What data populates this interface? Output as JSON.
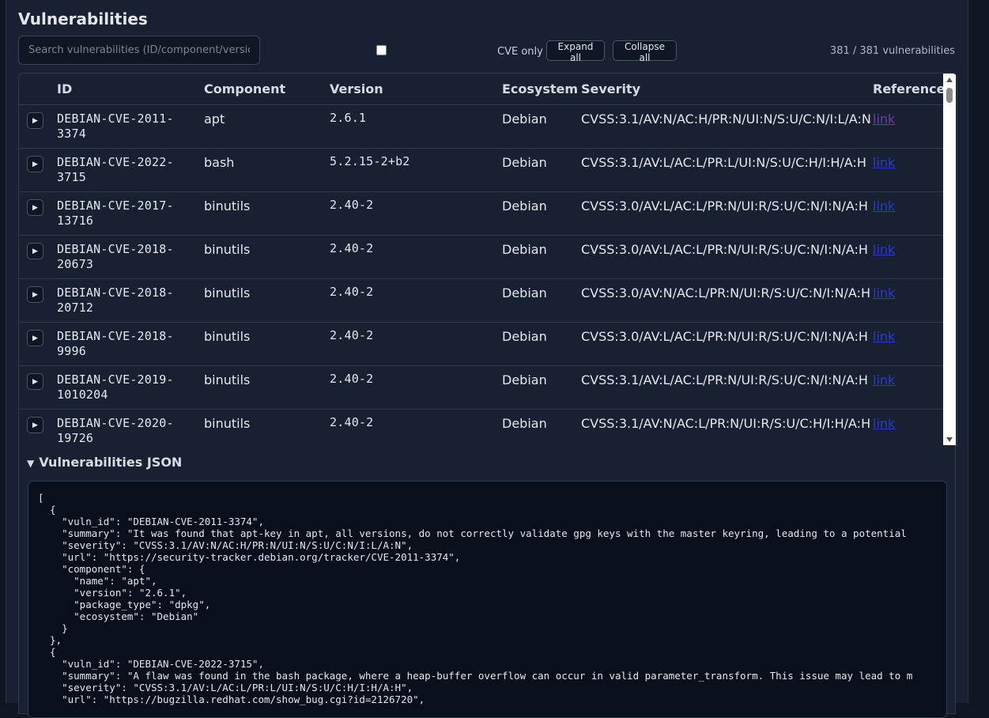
{
  "title": "Vulnerabilities",
  "search": {
    "placeholder": "Search vulnerabilities (ID/component/version/severity)"
  },
  "filters": {
    "cve_only_label": "CVE only",
    "cve_only_checked": false
  },
  "buttons": {
    "expand_all": "Expand all",
    "collapse_all": "Collapse all"
  },
  "count_label": "381 / 381 vulnerabilities",
  "table": {
    "headers": {
      "id": "ID",
      "component": "Component",
      "version": "Version",
      "ecosystem": "Ecosystem",
      "severity": "Severity",
      "reference": "Reference"
    },
    "toggle_glyph": "▶",
    "rows": [
      {
        "id": "DEBIAN-CVE-2011-3374",
        "component": "apt",
        "version": "2.6.1",
        "ecosystem": "Debian",
        "severity": "CVSS:3.1/AV:N/AC:H/PR:N/UI:N/S:U/C:N/I:L/A:N",
        "reference": "link",
        "visited": true
      },
      {
        "id": "DEBIAN-CVE-2022-3715",
        "component": "bash",
        "version": "5.2.15-2+b2",
        "ecosystem": "Debian",
        "severity": "CVSS:3.1/AV:L/AC:L/PR:L/UI:N/S:U/C:H/I:H/A:H",
        "reference": "link",
        "visited": false
      },
      {
        "id": "DEBIAN-CVE-2017-13716",
        "component": "binutils",
        "version": "2.40-2",
        "ecosystem": "Debian",
        "severity": "CVSS:3.0/AV:L/AC:L/PR:N/UI:R/S:U/C:N/I:N/A:H",
        "reference": "link",
        "visited": false
      },
      {
        "id": "DEBIAN-CVE-2018-20673",
        "component": "binutils",
        "version": "2.40-2",
        "ecosystem": "Debian",
        "severity": "CVSS:3.0/AV:L/AC:L/PR:N/UI:R/S:U/C:N/I:N/A:H",
        "reference": "link",
        "visited": false
      },
      {
        "id": "DEBIAN-CVE-2018-20712",
        "component": "binutils",
        "version": "2.40-2",
        "ecosystem": "Debian",
        "severity": "CVSS:3.0/AV:N/AC:L/PR:N/UI:R/S:U/C:N/I:N/A:H",
        "reference": "link",
        "visited": false
      },
      {
        "id": "DEBIAN-CVE-2018-9996",
        "component": "binutils",
        "version": "2.40-2",
        "ecosystem": "Debian",
        "severity": "CVSS:3.0/AV:L/AC:L/PR:N/UI:R/S:U/C:N/I:N/A:H",
        "reference": "link",
        "visited": false
      },
      {
        "id": "DEBIAN-CVE-2019-1010204",
        "component": "binutils",
        "version": "2.40-2",
        "ecosystem": "Debian",
        "severity": "CVSS:3.1/AV:L/AC:L/PR:N/UI:R/S:U/C:N/I:N/A:H",
        "reference": "link",
        "visited": false
      },
      {
        "id": "DEBIAN-CVE-2020-19726",
        "component": "binutils",
        "version": "2.40-2",
        "ecosystem": "Debian",
        "severity": "CVSS:3.1/AV:N/AC:L/PR:N/UI:R/S:U/C:H/I:H/A:H",
        "reference": "link",
        "visited": false
      }
    ]
  },
  "json_section": {
    "summary": "Vulnerabilities JSON",
    "text": "[\n  {\n    \"vuln_id\": \"DEBIAN-CVE-2011-3374\",\n    \"summary\": \"It was found that apt-key in apt, all versions, do not correctly validate gpg keys with the master keyring, leading to a potential\n    \"severity\": \"CVSS:3.1/AV:N/AC:H/PR:N/UI:N/S:U/C:N/I:L/A:N\",\n    \"url\": \"https://security-tracker.debian.org/tracker/CVE-2011-3374\",\n    \"component\": {\n      \"name\": \"apt\",\n      \"version\": \"2.6.1\",\n      \"package_type\": \"dpkg\",\n      \"ecosystem\": \"Debian\"\n    }\n  },\n  {\n    \"vuln_id\": \"DEBIAN-CVE-2022-3715\",\n    \"summary\": \"A flaw was found in the bash package, where a heap-buffer overflow can occur in valid parameter_transform. This issue may lead to m\n    \"severity\": \"CVSS:3.1/AV:L/AC:L/PR:L/UI:N/S:U/C:H/I:H/A:H\",\n    \"url\": \"https://bugzilla.redhat.com/show_bug.cgi?id=2126720\","
  },
  "colors": {
    "background": "#0f1624",
    "panel": "#172131",
    "link": "#2b3ad1",
    "link_visited": "#6b3fae",
    "code_bg": "#0a0f1c"
  }
}
